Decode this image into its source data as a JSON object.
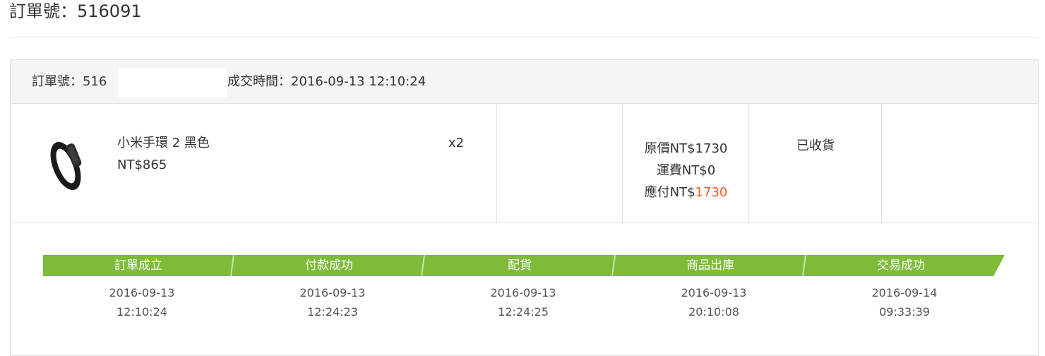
{
  "page": {
    "title": "訂單號：516091"
  },
  "order": {
    "order_no_label": "訂單號：516",
    "deal_time_label": "成交時間：2016-09-13 12:10:24"
  },
  "item": {
    "name": "小米手環 2 黑色",
    "unit_price": "NT$865",
    "quantity": "x2",
    "thumbnail_icon": "fitness-band-icon"
  },
  "amounts": {
    "original_label": "原價NT$1730",
    "shipping_label": "運費NT$0",
    "payable_prefix": "應付NT$",
    "payable_value": "1730",
    "highlight_color": "#ff5722"
  },
  "status": {
    "label": "已收貨"
  },
  "progress": {
    "bar_color": "#7dbb38",
    "steps": [
      {
        "label": "訂單成立",
        "date": "2016-09-13",
        "time": "12:10:24"
      },
      {
        "label": "付款成功",
        "date": "2016-09-13",
        "time": "12:24:23"
      },
      {
        "label": "配貨",
        "date": "2016-09-13",
        "time": "12:24:25"
      },
      {
        "label": "商品出庫",
        "date": "2016-09-13",
        "time": "20:10:08"
      },
      {
        "label": "交易成功",
        "date": "2016-09-14",
        "time": "09:33:39"
      }
    ]
  }
}
